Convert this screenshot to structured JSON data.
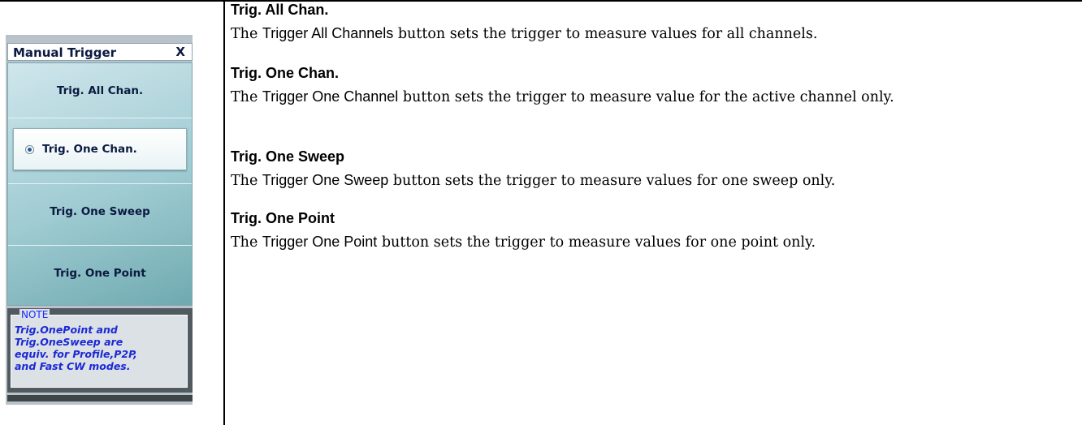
{
  "panel": {
    "title": "Manual Trigger",
    "close_label": "X",
    "buttons": [
      {
        "label": "Trig. All Chan."
      },
      {
        "label": "Trig. One Chan."
      },
      {
        "label": "Trig. One Sweep"
      },
      {
        "label": "Trig. One Point"
      }
    ],
    "note": {
      "label": "NOTE",
      "text": "Trig.OnePoint and\nTrig.OneSweep are\nequiv. for Profile,P2P,\nand Fast CW modes."
    }
  },
  "descriptions": [
    {
      "heading": "Trig. All Chan.",
      "pre": "The ",
      "ui": "Trigger All Channels",
      "post": " button sets the trigger to measure values for all channels."
    },
    {
      "heading": "Trig. One Chan.",
      "pre": "The ",
      "ui": "Trigger One Channel",
      "post": " button sets the trigger to measure value for the active channel only."
    },
    {
      "heading": "Trig. One Sweep",
      "pre": "The ",
      "ui": "Trigger One Sweep",
      "post": " button sets the trigger to measure values for one sweep only."
    },
    {
      "heading": "Trig. One Point",
      "pre": "The ",
      "ui": "Trigger One Point",
      "post": " button sets the trigger to measure values for one point only."
    }
  ]
}
